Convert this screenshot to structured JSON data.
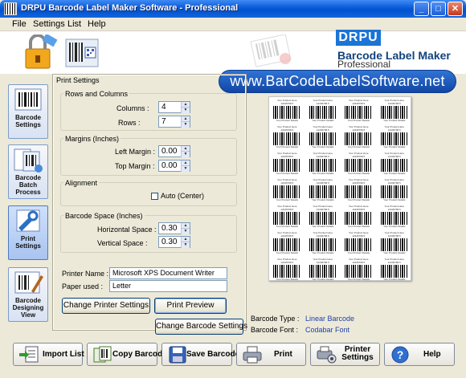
{
  "window": {
    "title": "DRPU Barcode Label Maker Software - Professional",
    "controls": {
      "minimize": "_",
      "maximize": "□",
      "close": "✕"
    }
  },
  "menu": {
    "items": [
      "File",
      "Settings",
      "List",
      "Help"
    ]
  },
  "banner": {
    "brand": "DRPU",
    "product": "Barcode Label Maker",
    "edition": "Professional",
    "url": "www.BarCodeLabelSoftware.net"
  },
  "sidebar": {
    "items": [
      {
        "label": "Barcode Settings",
        "icon": "barcode-settings-icon"
      },
      {
        "label": "Barcode Batch Process",
        "icon": "batch-process-icon"
      },
      {
        "label": "Print Settings",
        "icon": "print-settings-icon",
        "active": true
      },
      {
        "label": "Barcode Designing View",
        "icon": "designing-view-icon"
      }
    ]
  },
  "print_settings": {
    "title": "Print Settings",
    "rows_columns": {
      "label": "Rows and Columns",
      "columns_label": "Columns :",
      "columns": "4",
      "rows_label": "Rows :",
      "rows": "7"
    },
    "margins": {
      "label": "Margins (Inches)",
      "left_label": "Left Margin :",
      "left": "0.00",
      "top_label": "Top Margin :",
      "top": "0.00"
    },
    "alignment": {
      "label": "Alignment",
      "auto_center_label": "Auto (Center)",
      "auto_center": false
    },
    "barcode_space": {
      "label": "Barcode Space (Inches)",
      "horizontal_label": "Horizontal Space :",
      "horizontal": "0.30",
      "vertical_label": "Vertical Space :",
      "vertical": "0.30"
    },
    "printer": {
      "name_label": "Printer Name :",
      "name": "Microsoft XPS Document Writer",
      "paper_label": "Paper used :",
      "paper": "Letter"
    },
    "buttons": {
      "change_printer": "Change Printer Settings",
      "print_preview": "Print Preview",
      "change_barcode": "Change Barcode Settings"
    }
  },
  "preview": {
    "columns": 4,
    "rows": 7,
    "label_top": "Your Product Here",
    "label_code": "12345768 5",
    "label_bottom": "Your Product Details"
  },
  "barcode_info": {
    "type_label": "Barcode Type :",
    "type": "Linear Barcode",
    "font_label": "Barcode Font :",
    "font": "Codabar Font"
  },
  "footer": {
    "buttons": [
      {
        "label": "Import List",
        "icon": "import-list-icon"
      },
      {
        "label": "Copy Barcode",
        "icon": "copy-barcode-icon"
      },
      {
        "label": "Save Barcode",
        "icon": "save-barcode-icon"
      },
      {
        "label": "Print",
        "icon": "printer-icon"
      },
      {
        "label": "Printer Settings",
        "icon": "printer-settings-icon"
      },
      {
        "label": "Help",
        "icon": "help-icon"
      }
    ]
  }
}
